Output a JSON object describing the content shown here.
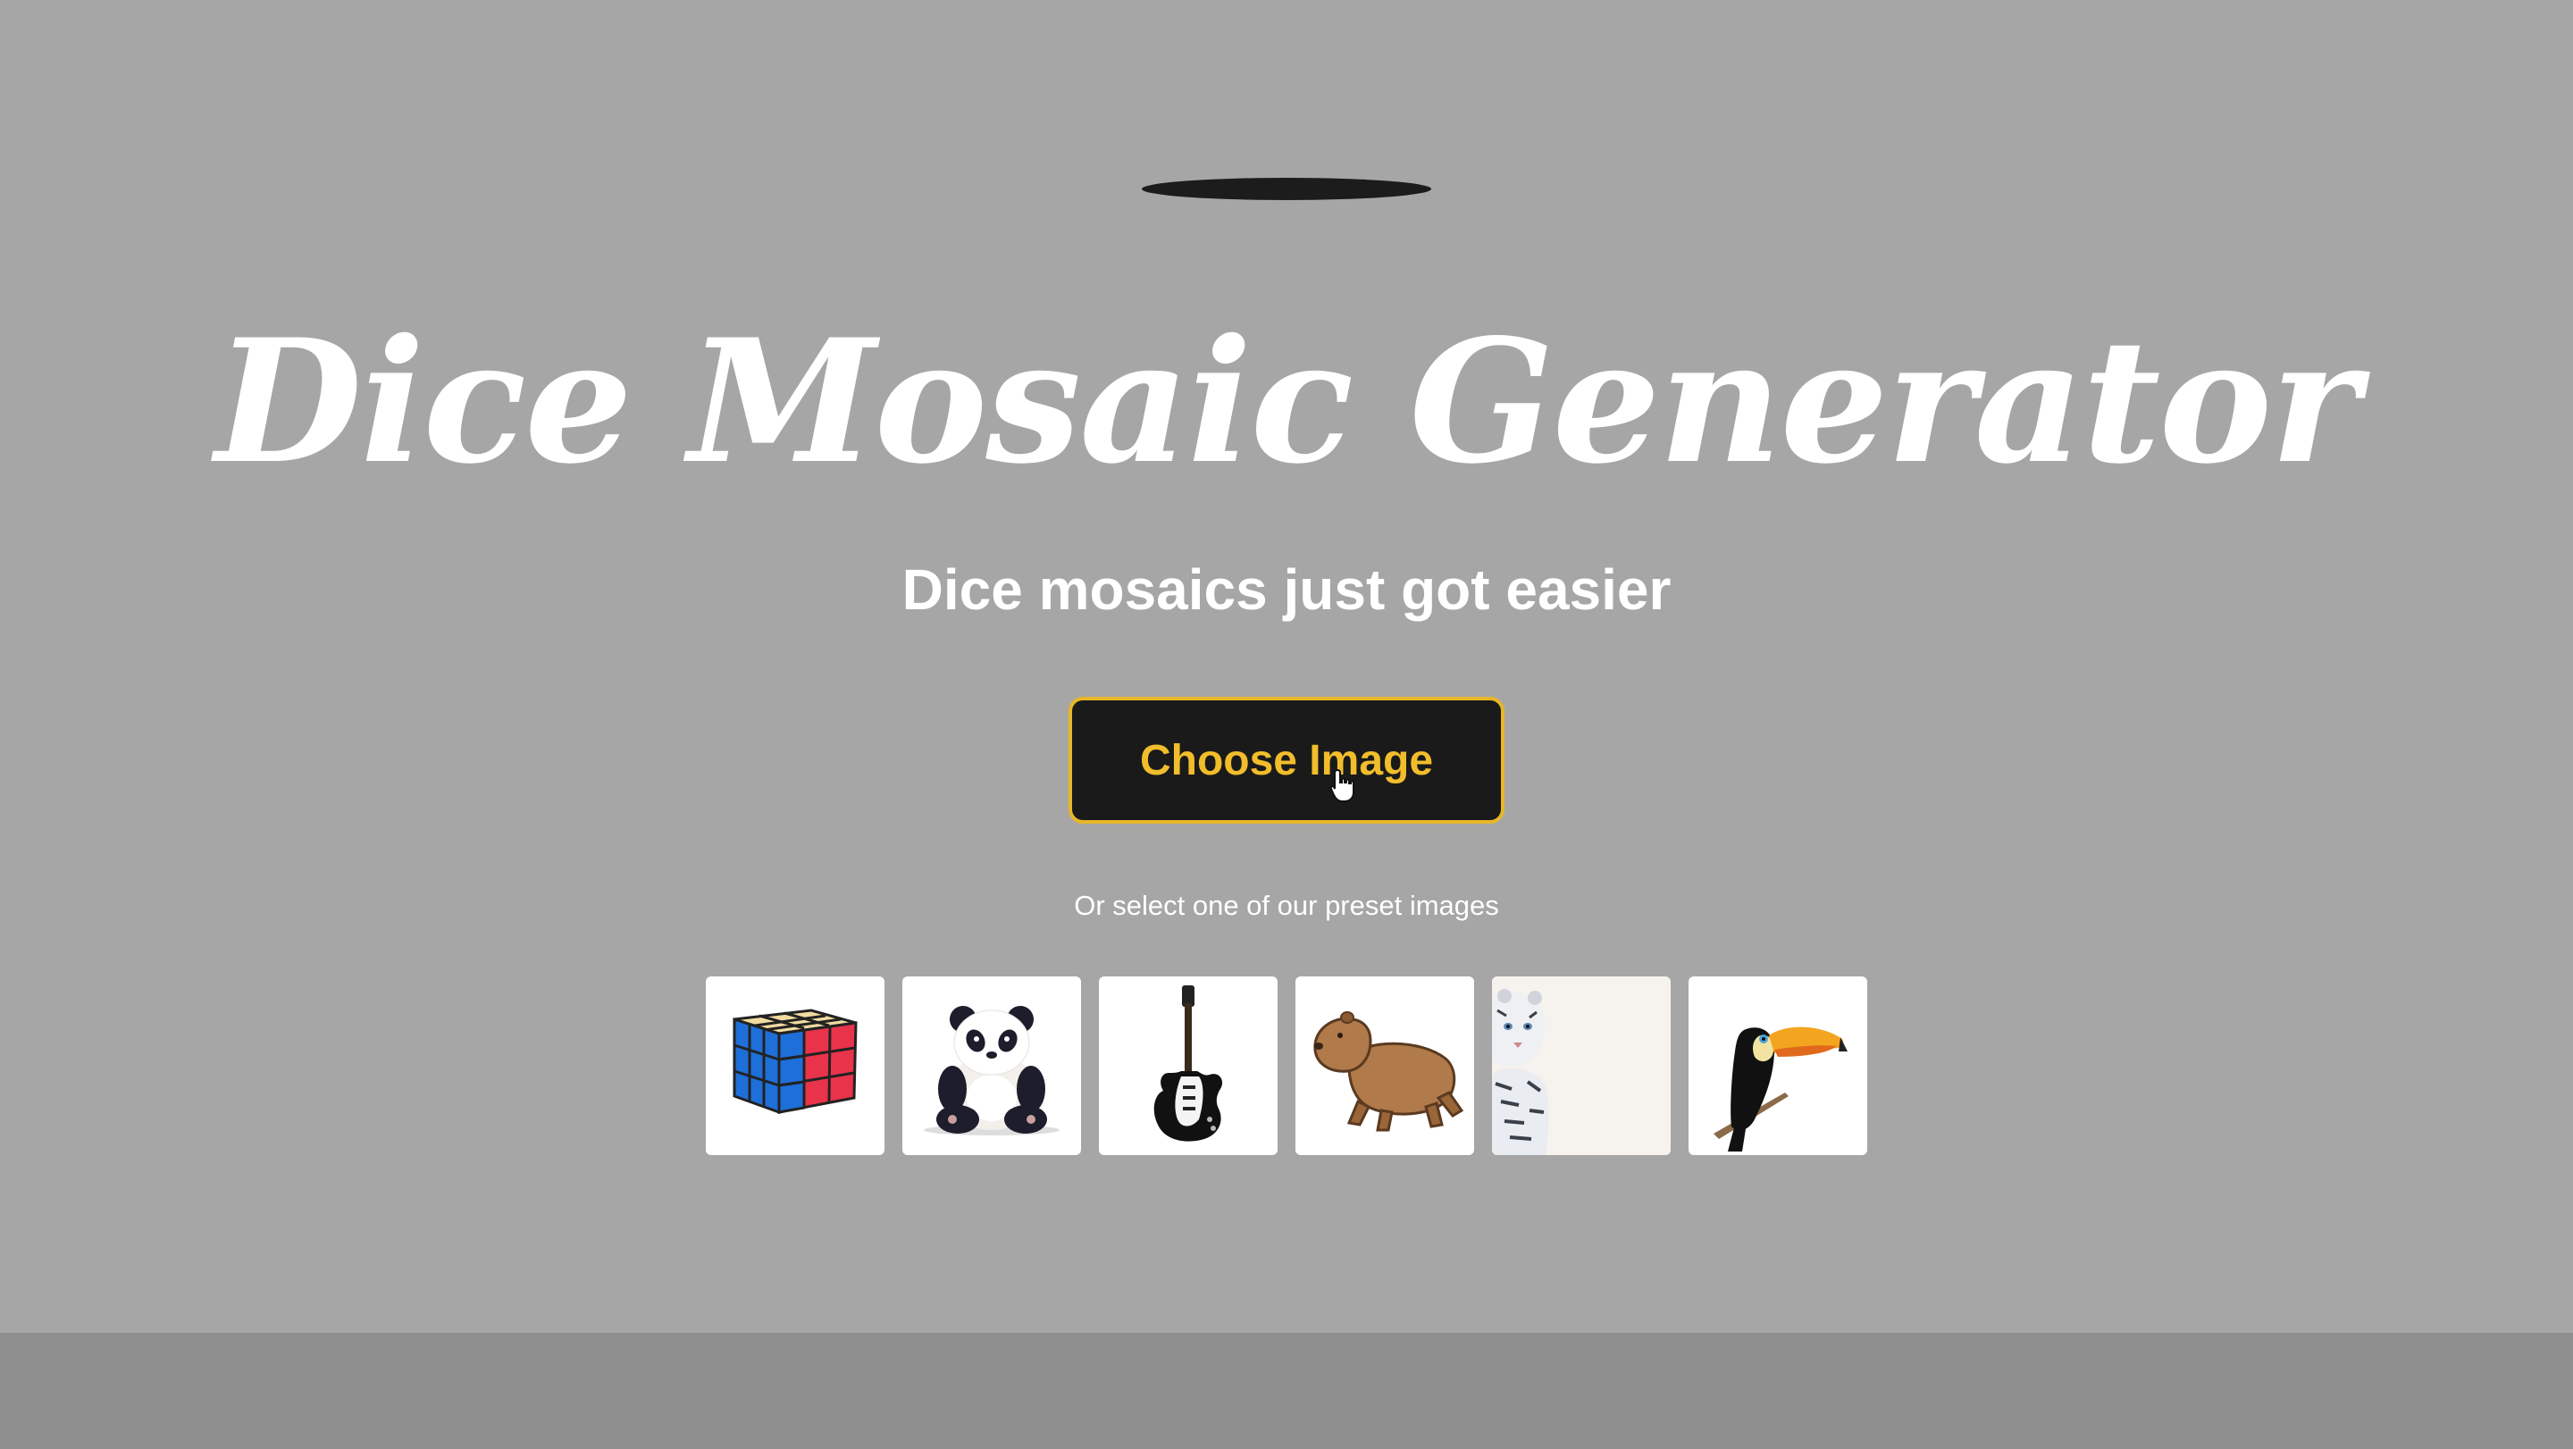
{
  "title": "Dice Mosaic Generator",
  "subtitle": "Dice mosaics just got easier",
  "upload": {
    "button_label": "Choose Image"
  },
  "presets": {
    "caption": "Or select one of our preset images",
    "items": [
      {
        "icon": "rubiks-cube-icon"
      },
      {
        "icon": "panda-icon"
      },
      {
        "icon": "electric-guitar-icon"
      },
      {
        "icon": "capybara-icon"
      },
      {
        "icon": "white-tiger-cub-icon"
      },
      {
        "icon": "toucan-icon"
      }
    ]
  },
  "colors": {
    "background": "#a6a6a6",
    "footer_band": "#8f8f8f",
    "button_background": "#1a1a1a",
    "button_accent": "#f1bd2b",
    "text": "#ffffff"
  }
}
